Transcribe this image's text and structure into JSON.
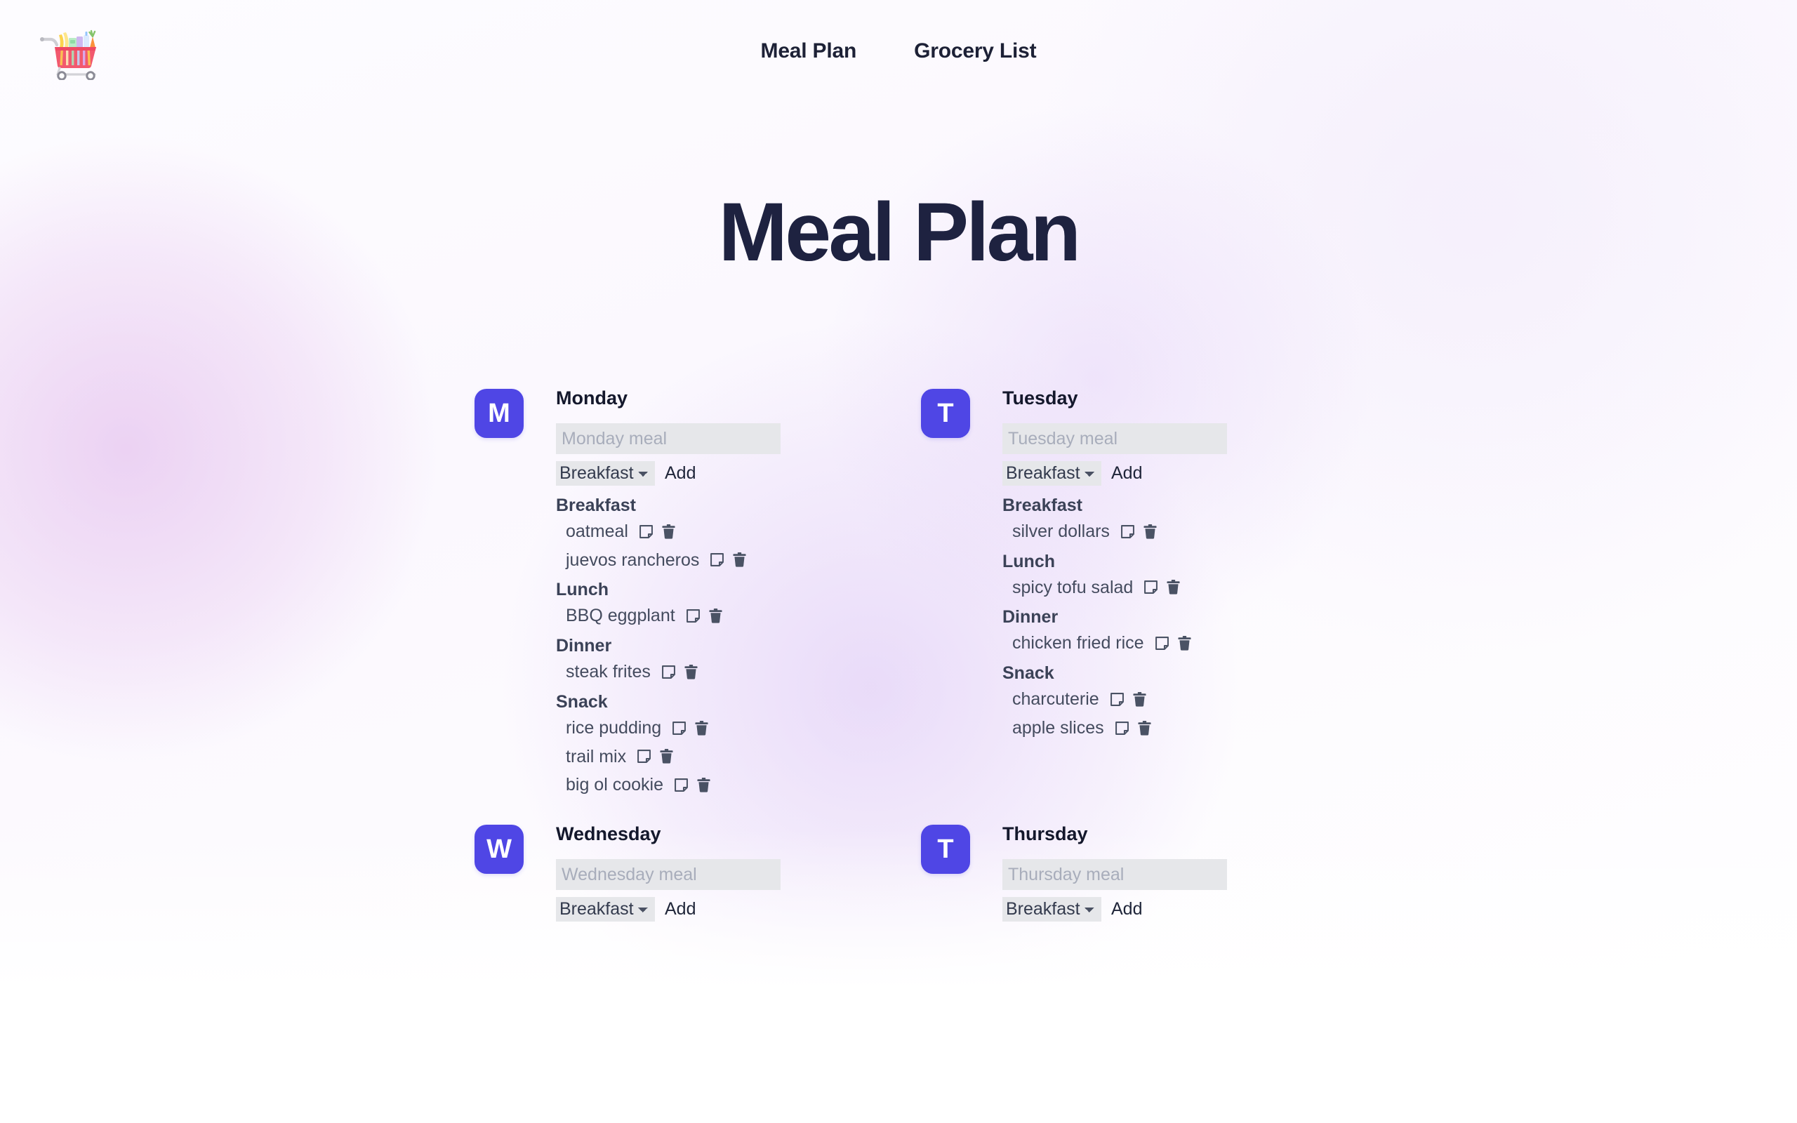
{
  "app": {
    "logo_icon": "shopping-cart-icon",
    "accent_color": "#4f46e5",
    "title_color": "#1e2240"
  },
  "nav": {
    "items": [
      {
        "label": "Meal Plan",
        "name": "nav-meal-plan"
      },
      {
        "label": "Grocery List",
        "name": "nav-grocery-list"
      }
    ]
  },
  "page": {
    "title": "Meal Plan"
  },
  "controls": {
    "add_label": "Add",
    "meal_type_selected": "Breakfast",
    "meal_type_options": [
      "Breakfast",
      "Lunch",
      "Dinner",
      "Snack"
    ],
    "note_icon": "note-icon",
    "delete_icon": "trash-icon"
  },
  "days": [
    {
      "name": "Monday",
      "initial": "M",
      "input_placeholder": "Monday meal",
      "input_value": "",
      "sections": [
        {
          "title": "Breakfast",
          "items": [
            {
              "name": "oatmeal"
            },
            {
              "name": "juevos rancheros"
            }
          ]
        },
        {
          "title": "Lunch",
          "items": [
            {
              "name": "BBQ eggplant"
            }
          ]
        },
        {
          "title": "Dinner",
          "items": [
            {
              "name": "steak frites"
            }
          ]
        },
        {
          "title": "Snack",
          "items": [
            {
              "name": "rice pudding"
            },
            {
              "name": "trail mix"
            },
            {
              "name": "big ol cookie"
            }
          ]
        }
      ]
    },
    {
      "name": "Tuesday",
      "initial": "T",
      "input_placeholder": "Tuesday meal",
      "input_value": "",
      "sections": [
        {
          "title": "Breakfast",
          "items": [
            {
              "name": "silver dollars"
            }
          ]
        },
        {
          "title": "Lunch",
          "items": [
            {
              "name": "spicy tofu salad"
            }
          ]
        },
        {
          "title": "Dinner",
          "items": [
            {
              "name": "chicken fried rice"
            }
          ]
        },
        {
          "title": "Snack",
          "items": [
            {
              "name": "charcuterie"
            },
            {
              "name": "apple slices"
            }
          ]
        }
      ]
    },
    {
      "name": "Wednesday",
      "initial": "W",
      "input_placeholder": "Wednesday meal",
      "input_value": "",
      "sections": []
    },
    {
      "name": "Thursday",
      "initial": "T",
      "input_placeholder": "Thursday meal",
      "input_value": "",
      "sections": []
    }
  ]
}
